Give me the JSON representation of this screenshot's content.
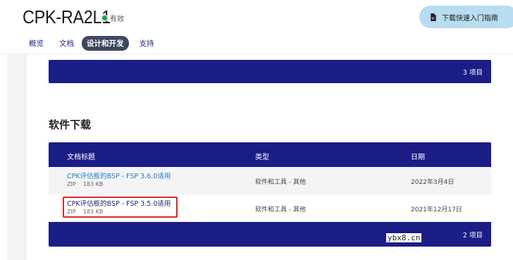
{
  "product": {
    "name": "CPK-RA2L1",
    "status": "有效",
    "status_color": "#2e9b5a"
  },
  "quickstart": {
    "label": "下载快速入门指南",
    "icon": "document-icon"
  },
  "tabs": [
    {
      "label": "概览"
    },
    {
      "label": "文档"
    },
    {
      "label": "设计和开发",
      "active": true
    },
    {
      "label": "支持"
    }
  ],
  "top_section": {
    "count": "3 项目"
  },
  "software": {
    "title": "软件下载",
    "columns": {
      "title": "文档标题",
      "type": "类型",
      "date": "日期"
    },
    "rows": [
      {
        "title": "CPK评估板的BSP - FSP 3.6.0适用",
        "format": "ZIP",
        "size": "183 KB",
        "type": "软件和工具 - 其他",
        "date": "2022年3月4日"
      },
      {
        "title": "CPK评估板的BSP - FSP 3.5.0适用",
        "format": "ZIP",
        "size": "183 KB",
        "type": "软件和工具 - 其他",
        "date": "2021年12月17日",
        "highlighted": true
      }
    ],
    "count": "2 项目"
  },
  "watermark": "ybx8.cn",
  "colors": {
    "header_bar": "#1b1d86",
    "link": "#1f7fb8",
    "highlight": "#d9262a",
    "button_bg": "#b8dcf0"
  }
}
